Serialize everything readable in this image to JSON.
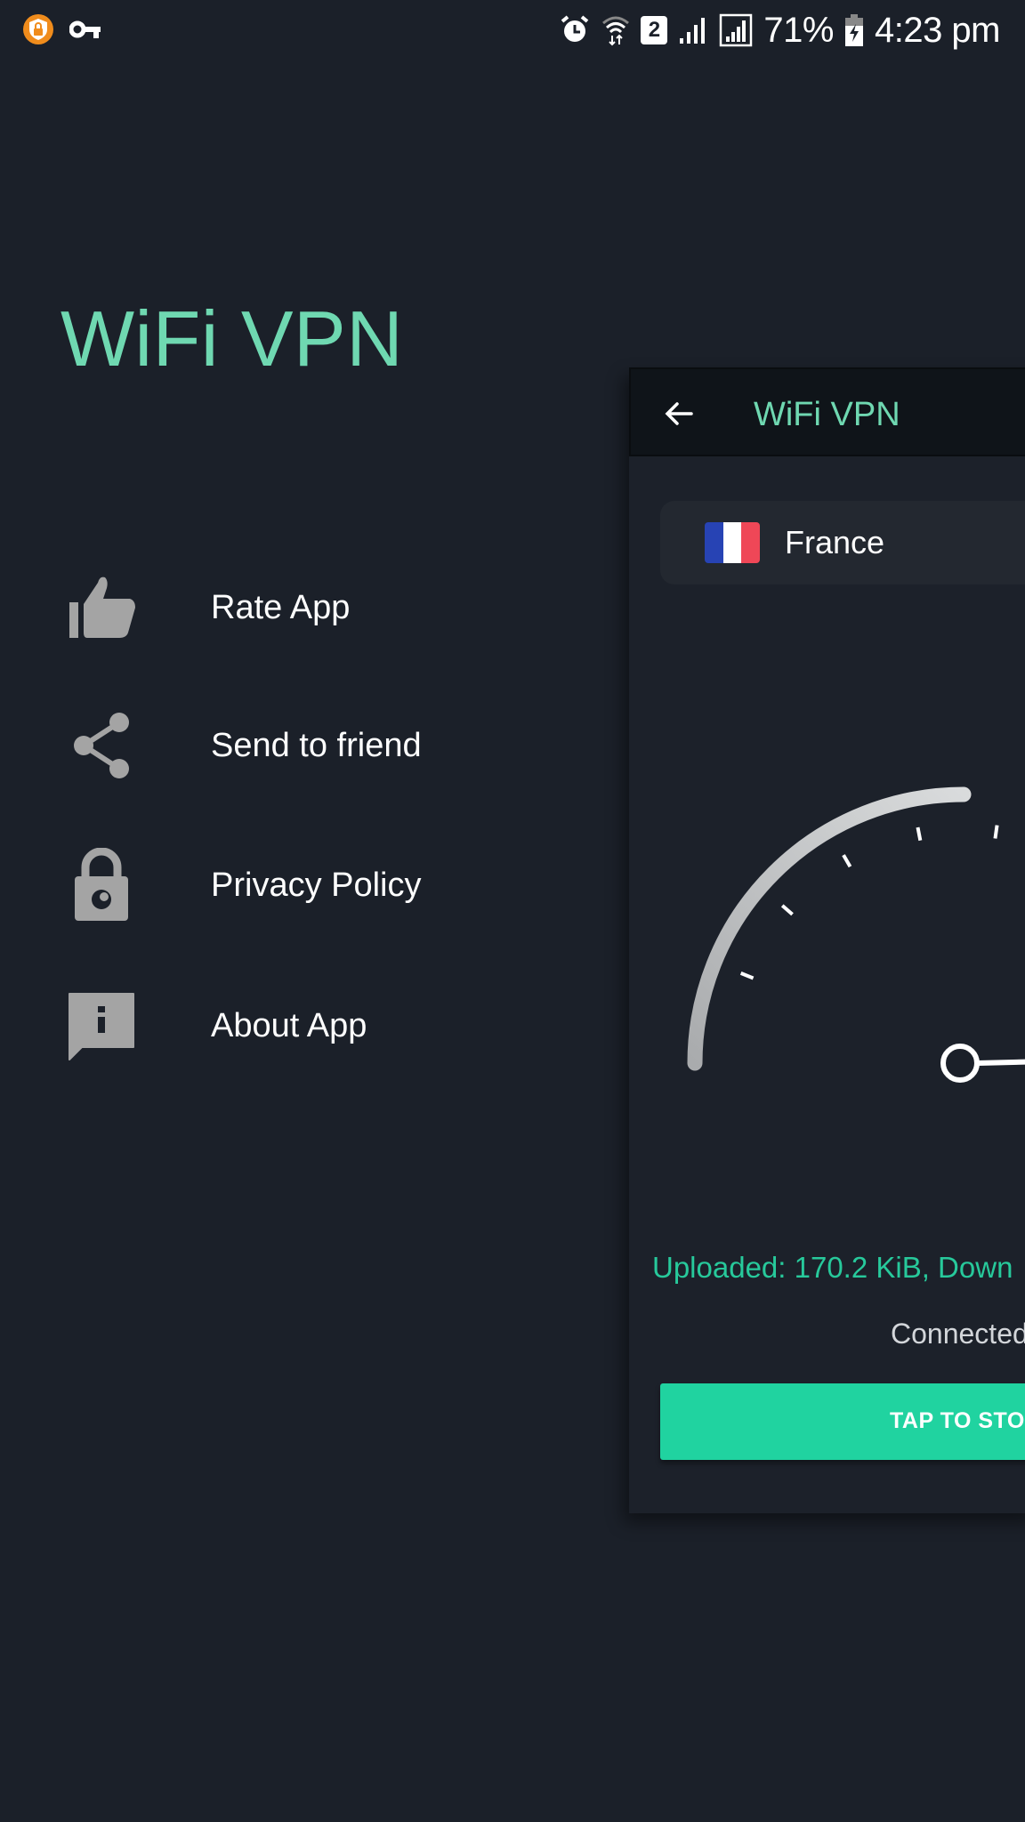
{
  "status_bar": {
    "left_icons": [
      "vpn-shield-lock-icon",
      "vpn-key-icon"
    ],
    "right_icons": [
      "alarm-icon",
      "wifi-data-icon",
      "sim-2-icon",
      "signal-icon",
      "signal-boxed-icon",
      "battery-charging-icon"
    ],
    "sim_label": "2",
    "battery": "71%",
    "time": "4:23 pm"
  },
  "drawer": {
    "title": "WiFi VPN",
    "items": [
      {
        "icon": "thumbs-up-icon",
        "label": "Rate App"
      },
      {
        "icon": "share-icon",
        "label": "Send to friend"
      },
      {
        "icon": "privacy-lock-icon",
        "label": "Privacy Policy"
      },
      {
        "icon": "info-message-icon",
        "label": "About App"
      }
    ]
  },
  "main": {
    "appbar": {
      "back_icon": "arrow-back-icon",
      "title": "WiFi VPN"
    },
    "server": {
      "country": "France",
      "flag_colors": [
        "#2743b4",
        "#ffffff",
        "#ef4757"
      ]
    },
    "gauge": {
      "ticks_visible": 6,
      "needle_value": 0
    },
    "traffic_text": "Uploaded: 170.2 KiB, Down",
    "status_text": "Connected",
    "action_button": "TAP TO STOP"
  },
  "colors": {
    "accent": "#6fd8b1",
    "button": "#20d3a0",
    "traffic_text": "#27c99b",
    "background": "#1b2029",
    "icon_gray": "#a4a4a4"
  }
}
